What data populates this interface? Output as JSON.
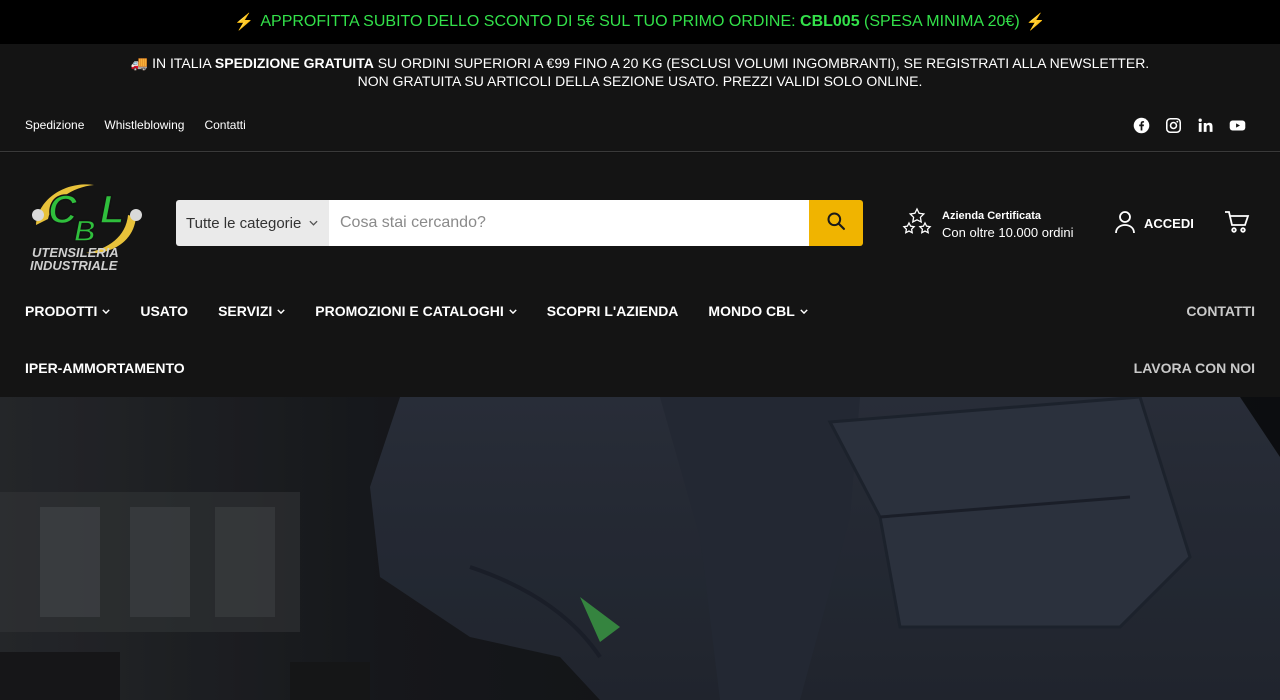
{
  "promo": {
    "bolt_left": "⚡",
    "text_before": "APPROFITTA SUBITO DELLO SCONTO DI 5€ SUL TUO PRIMO ORDINE: ",
    "code": "CBL005",
    "text_after": " (SPESA MINIMA 20€)",
    "bolt_right": "⚡"
  },
  "shipping": {
    "truck": "🚚",
    "line1_before": " IN ITALIA ",
    "line1_bold": "SPEDIZIONE GRATUITA",
    "line1_after": " SU ORDINI SUPERIORI A €99 FINO A 20 KG (ESCLUSI VOLUMI INGOMBRANTI), SE REGISTRATI ALLA NEWSLETTER.",
    "line2": "NON GRATUITA SU ARTICOLI DELLA SEZIONE USATO. PREZZI VALIDI SOLO ONLINE."
  },
  "util_links": [
    "Spedizione",
    "Whistleblowing",
    "Contatti"
  ],
  "socials": [
    "facebook-icon",
    "instagram-icon",
    "linkedin-icon",
    "youtube-icon"
  ],
  "logo": {
    "letters": "CBL",
    "line1": "UTENSILERIA",
    "line2": "INDUSTRIALE"
  },
  "search": {
    "category": "Tutte le categorie",
    "placeholder": "Cosa stai cercando?",
    "button_icon": "search-icon"
  },
  "cert": {
    "title": "Azienda Certificata",
    "subtitle": "Con oltre 10.000 ordini"
  },
  "account": {
    "label": "ACCEDI"
  },
  "nav": {
    "row1": [
      {
        "label": "PRODOTTI",
        "dropdown": true
      },
      {
        "label": "USATO",
        "dropdown": false
      },
      {
        "label": "SERVIZI",
        "dropdown": true
      },
      {
        "label": "PROMOZIONI E CATALOGHI",
        "dropdown": true
      },
      {
        "label": "SCOPRI L'AZIENDA",
        "dropdown": false
      },
      {
        "label": "MONDO CBL",
        "dropdown": true
      }
    ],
    "row1_right": "CONTATTI",
    "row2": [
      {
        "label": "IPER-AMMORTAMENTO",
        "dropdown": false
      }
    ],
    "row2_right": "LAVORA CON NOI"
  },
  "colors": {
    "promo_green": "#33e14a",
    "search_button": "#f0b400",
    "background": "#141414"
  }
}
